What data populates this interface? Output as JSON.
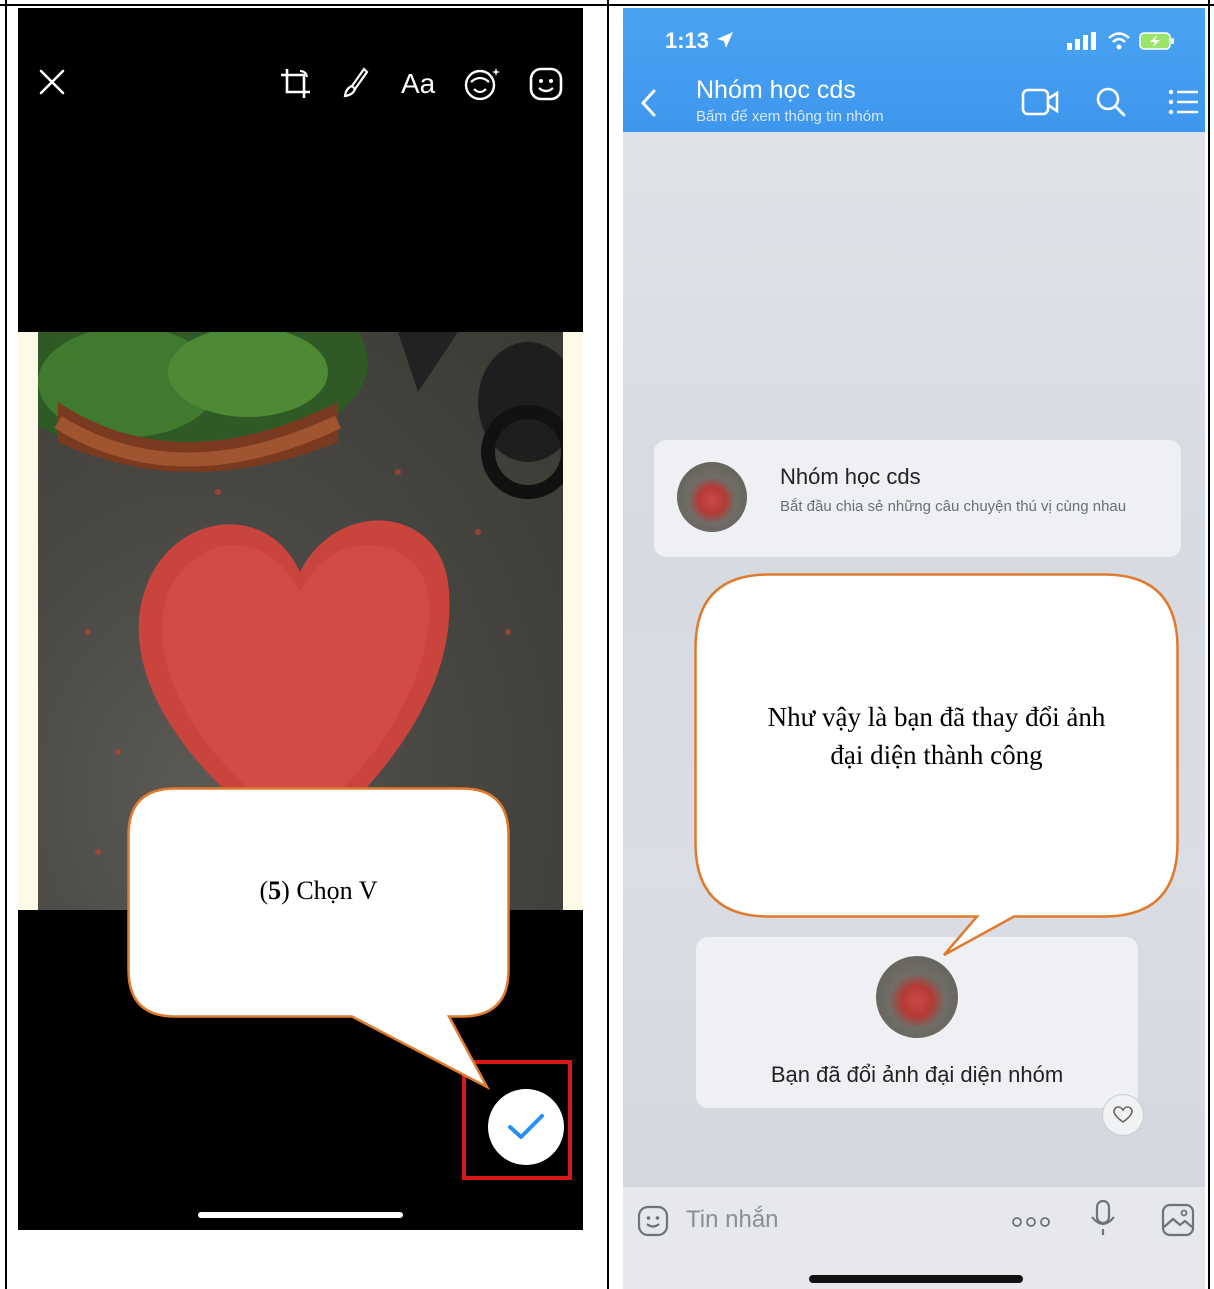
{
  "left": {
    "tools": [
      {
        "name": "close-icon"
      },
      {
        "name": "crop-icon"
      },
      {
        "name": "brush-icon"
      },
      {
        "name": "text-tool",
        "label": "Aa"
      },
      {
        "name": "face-filter-icon"
      },
      {
        "name": "sticker-icon"
      }
    ],
    "callout": {
      "step_number": "5",
      "open": "(",
      "close": ")",
      "text": " Chọn V"
    }
  },
  "right": {
    "status": {
      "time": "1:13"
    },
    "header": {
      "title": "Nhóm học cds",
      "subtitle": "Bấm để xem thông tin nhóm"
    },
    "group_card": {
      "title": "Nhóm học cds",
      "description": "Bắt đầu chia sẻ những câu chuyện thú vị cùng nhau"
    },
    "notice": {
      "text": "Bạn đã đổi ảnh đại diện nhóm"
    },
    "callout": {
      "line1": "Như vậy là bạn đã thay đổi ảnh",
      "line2": "đại diện thành công"
    },
    "composer": {
      "placeholder": "Tin nhắn"
    }
  },
  "colors": {
    "accent_blue": "#3e97ee",
    "callout_border": "#e07a2e",
    "highlight_red": "#d61a1a"
  }
}
